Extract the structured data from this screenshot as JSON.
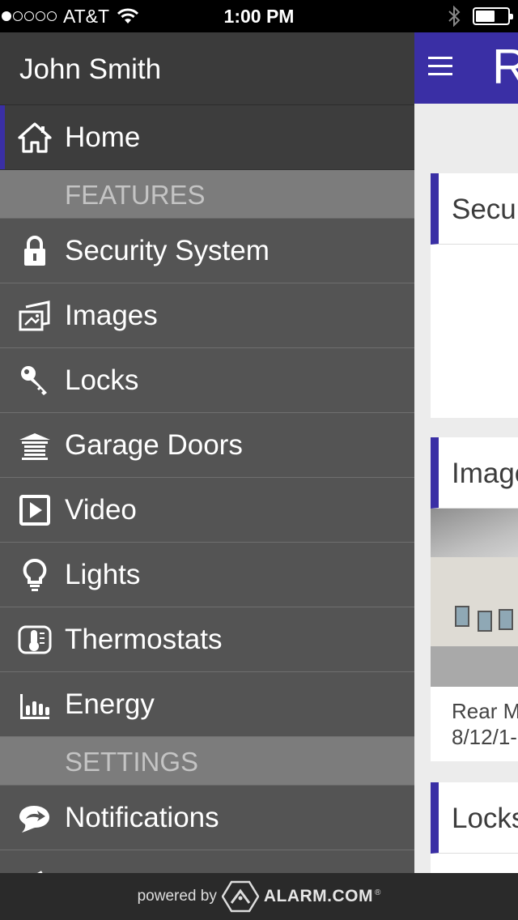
{
  "status_bar": {
    "carrier": "AT&T",
    "signal_bars": 1,
    "time": "1:00 PM",
    "battery_level": 0.55
  },
  "drawer": {
    "user_name": "John Smith",
    "home": {
      "label": "Home",
      "icon": "home-icon",
      "active": true
    },
    "sections": [
      {
        "title": "FEATURES",
        "items": [
          {
            "label": "Security System",
            "icon": "lock-icon"
          },
          {
            "label": "Images",
            "icon": "images-icon"
          },
          {
            "label": "Locks",
            "icon": "key-icon"
          },
          {
            "label": "Garage Doors",
            "icon": "garage-icon"
          },
          {
            "label": "Video",
            "icon": "video-icon"
          },
          {
            "label": "Lights",
            "icon": "lightbulb-icon"
          },
          {
            "label": "Thermostats",
            "icon": "thermostat-icon"
          },
          {
            "label": "Energy",
            "icon": "energy-icon"
          }
        ]
      },
      {
        "title": "SETTINGS",
        "items": [
          {
            "label": "Notifications",
            "icon": "notifications-icon"
          }
        ]
      }
    ]
  },
  "footer": {
    "powered_by": "powered by",
    "brand": "ALARM.COM",
    "brand_mark": "®"
  },
  "main": {
    "title": "R",
    "cards": [
      {
        "title": "Secu"
      },
      {
        "title": "Image",
        "caption_line1": "Rear M",
        "caption_line2": "8/12/1-"
      },
      {
        "title": "Locks"
      }
    ]
  },
  "colors": {
    "accent": "#3a2fa5",
    "drawer_bg": "#545454",
    "section_bg": "#7c7c7c",
    "header_bg": "#3b3b3b",
    "footer_bg": "#2a2a2a"
  }
}
